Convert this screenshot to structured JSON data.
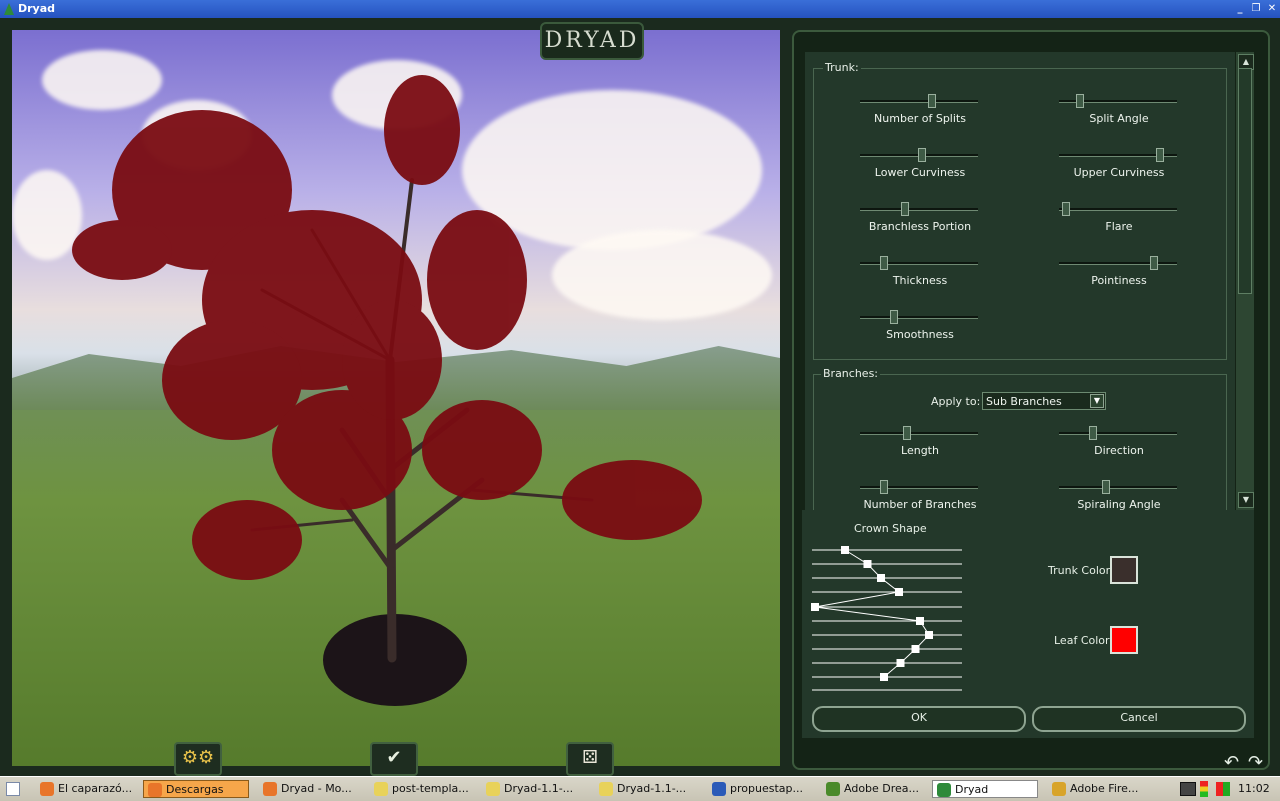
{
  "window": {
    "title": "Dryad",
    "logo": "DRYAD"
  },
  "window_controls": [
    {
      "icon": "minimize-icon",
      "glyph": "_"
    },
    {
      "icon": "restore-icon",
      "glyph": "❐"
    },
    {
      "icon": "close-icon",
      "glyph": "✕"
    }
  ],
  "viewport_buttons": [
    {
      "icon": "gears-icon",
      "glyph": "⚙⚙"
    },
    {
      "icon": "checkmark-icon",
      "glyph": "✔"
    },
    {
      "icon": "dice-icon",
      "glyph": "⚄"
    }
  ],
  "corner_icons": [
    {
      "icon": "undo-icon",
      "glyph": "↶"
    },
    {
      "icon": "redo-icon",
      "glyph": "↷"
    }
  ],
  "trunk": {
    "title": "Trunk:",
    "sliders": [
      {
        "label": "Number of Splits",
        "value": 0.62
      },
      {
        "label": "Split Angle",
        "value": 0.15
      },
      {
        "label": "Lower Curviness",
        "value": 0.53
      },
      {
        "label": "Upper Curviness",
        "value": 0.88
      },
      {
        "label": "Branchless Portion",
        "value": 0.37
      },
      {
        "label": "Flare",
        "value": 0.03
      },
      {
        "label": "Thickness",
        "value": 0.18
      },
      {
        "label": "Pointiness",
        "value": 0.83
      },
      {
        "label": "Smoothness",
        "value": 0.27
      }
    ]
  },
  "branches": {
    "title": "Branches:",
    "apply_to_label": "Apply to:",
    "apply_to_value": "Sub Branches",
    "sliders": [
      {
        "label": "Length",
        "value": 0.39
      },
      {
        "label": "Direction",
        "value": 0.27
      },
      {
        "label": "Number of Branches",
        "value": 0.18
      },
      {
        "label": "Spiraling Angle",
        "value": 0.39
      }
    ]
  },
  "crown_shape": {
    "title": "Crown Shape",
    "points": [
      0.22,
      0.37,
      0.46,
      0.58,
      0.02,
      0.72,
      0.78,
      0.69,
      0.59,
      0.48
    ]
  },
  "colors": {
    "trunk_label": "Trunk Color",
    "trunk_color": "#3a2f2c",
    "leaf_label": "Leaf Color",
    "leaf_color": "#ff0000"
  },
  "buttons": {
    "ok": "OK",
    "cancel": "Cancel"
  },
  "taskbar": {
    "items": [
      {
        "label": "El caparazó...",
        "icon": "firefox-icon",
        "color": "#e8752a"
      },
      {
        "label": "Descargas",
        "icon": "firefox-icon",
        "color": "#e8752a",
        "state": "active"
      },
      {
        "label": "Dryad - Mo...",
        "icon": "firefox-icon",
        "color": "#e8752a"
      },
      {
        "label": "post-templa...",
        "icon": "folder-icon",
        "color": "#e8d25a"
      },
      {
        "label": "Dryad-1.1-...",
        "icon": "folder-icon",
        "color": "#e8d25a"
      },
      {
        "label": "Dryad-1.1-...",
        "icon": "folder-open-icon",
        "color": "#e8d25a"
      },
      {
        "label": "propuestap...",
        "icon": "word-icon",
        "color": "#2a5ab8"
      },
      {
        "label": "Adobe Drea...",
        "icon": "dreamweaver-icon",
        "color": "#4a8a2a"
      },
      {
        "label": "Dryad",
        "icon": "dryad-tree-icon",
        "color": "#2e8a3a",
        "state": "pressed"
      },
      {
        "label": "Adobe Fire...",
        "icon": "fireworks-icon",
        "color": "#d8a42a"
      }
    ],
    "clock": "11:02"
  }
}
